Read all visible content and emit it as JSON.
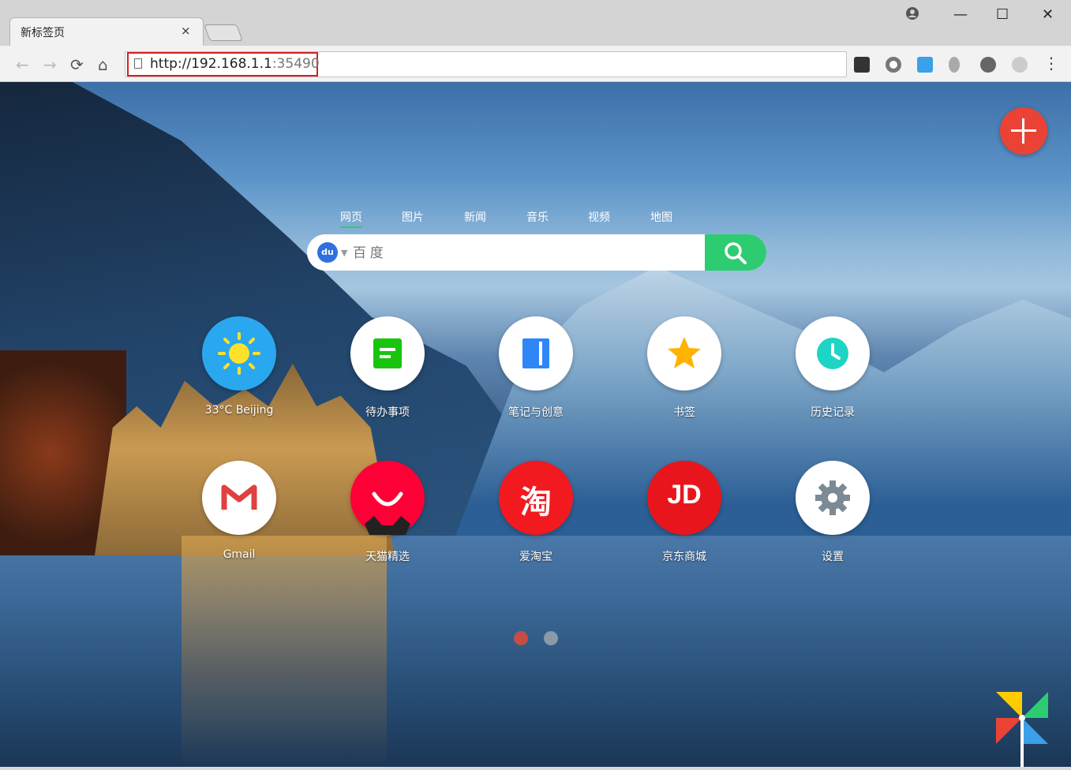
{
  "browser": {
    "tab_title": "新标签页",
    "tab_close": "×",
    "url_prefix": "http://192.168.1.1",
    "url_port": ":35490",
    "account_icon": "account-icon",
    "minimize": "—",
    "maximize": "☐",
    "close": "✕"
  },
  "search": {
    "tabs": [
      "网页",
      "图片",
      "新闻",
      "音乐",
      "视频",
      "地图"
    ],
    "active_tab": "网页",
    "engine_label": "du",
    "placeholder": "百 度"
  },
  "apps": [
    {
      "label": "33°C Beijing",
      "icon": "sun-icon",
      "color": "#29a8f0"
    },
    {
      "label": "待办事项",
      "icon": "todo-icon",
      "color": "#19c40f"
    },
    {
      "label": "笔记与创意",
      "icon": "notebook-icon",
      "color": "#2f86f7"
    },
    {
      "label": "书签",
      "icon": "star-icon",
      "color": "#ffb300"
    },
    {
      "label": "历史记录",
      "icon": "clock-icon",
      "color": "#1ed4c4"
    },
    {
      "label": "Gmail",
      "icon": "gmail-icon",
      "color": "#e04040"
    },
    {
      "label": "天猫精选",
      "icon": "tmall-icon",
      "color": "#ff0036"
    },
    {
      "label": "爱淘宝",
      "icon": "taobao-icon",
      "color": "#f2191f"
    },
    {
      "label": "京东商城",
      "icon": "jd-icon",
      "color": "#e8161c"
    },
    {
      "label": "设置",
      "icon": "gear-icon",
      "color": "#7c8a96"
    }
  ],
  "apps_glyphs": {
    "taobao": "淘",
    "jd": "JD"
  },
  "page_dots": {
    "active": 0,
    "count": 2
  },
  "accent": "#2ecc71"
}
